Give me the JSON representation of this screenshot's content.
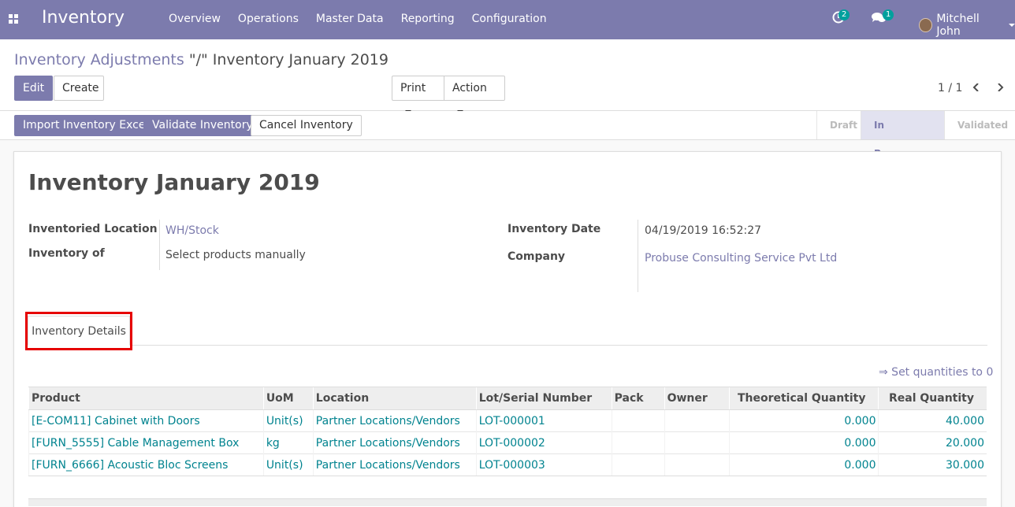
{
  "navbar": {
    "app_title": "Inventory",
    "menu": [
      "Overview",
      "Operations",
      "Master Data",
      "Reporting",
      "Configuration"
    ],
    "activity_count": "2",
    "message_count": "1",
    "user_name": "Mitchell John"
  },
  "control": {
    "breadcrumb_parent": "Inventory Adjustments",
    "breadcrumb_sep": "\"/\"",
    "breadcrumb_current": "Inventory January 2019",
    "edit_label": "Edit",
    "create_label": "Create",
    "print_label": "Print",
    "action_label": "Action",
    "pager": "1 / 1"
  },
  "statusbar": {
    "import_label": "Import Inventory Excel",
    "validate_label": "Validate Inventory",
    "cancel_label": "Cancel Inventory",
    "stages": [
      "Draft",
      "In Progress",
      "Validated"
    ],
    "active_stage": "In Progress"
  },
  "form": {
    "title": "Inventory January 2019",
    "inventoried_location_label": "Inventoried Location",
    "inventoried_location": "WH/Stock",
    "inventory_of_label": "Inventory of",
    "inventory_of": "Select products manually",
    "inventory_date_label": "Inventory Date",
    "inventory_date": "04/19/2019 16:52:27",
    "company_label": "Company",
    "company": "Probuse Consulting Service Pvt Ltd"
  },
  "tabs": {
    "details": "Inventory Details"
  },
  "lines": {
    "set_quantities": "⇒ Set quantities to 0",
    "headers": [
      "Product",
      "UoM",
      "Location",
      "Lot/Serial Number",
      "Pack",
      "Owner",
      "Theoretical Quantity",
      "Real Quantity"
    ],
    "rows": [
      {
        "product": "[E-COM11] Cabinet with Doors",
        "uom": "Unit(s)",
        "location": "Partner Locations/Vendors",
        "lot": "LOT-000001",
        "pack": "",
        "owner": "",
        "theoretical": "0.000",
        "real": "40.000"
      },
      {
        "product": "[FURN_5555] Cable Management Box",
        "uom": "kg",
        "location": "Partner Locations/Vendors",
        "lot": "LOT-000002",
        "pack": "",
        "owner": "",
        "theoretical": "0.000",
        "real": "20.000"
      },
      {
        "product": "[FURN_6666] Acoustic Bloc Screens",
        "uom": "Unit(s)",
        "location": "Partner Locations/Vendors",
        "lot": "LOT-000003",
        "pack": "",
        "owner": "",
        "theoretical": "0.000",
        "real": "30.000"
      }
    ]
  },
  "colors": {
    "brand": "#7c7bad",
    "link_teal": "#00838f",
    "highlight": "#e60000"
  }
}
